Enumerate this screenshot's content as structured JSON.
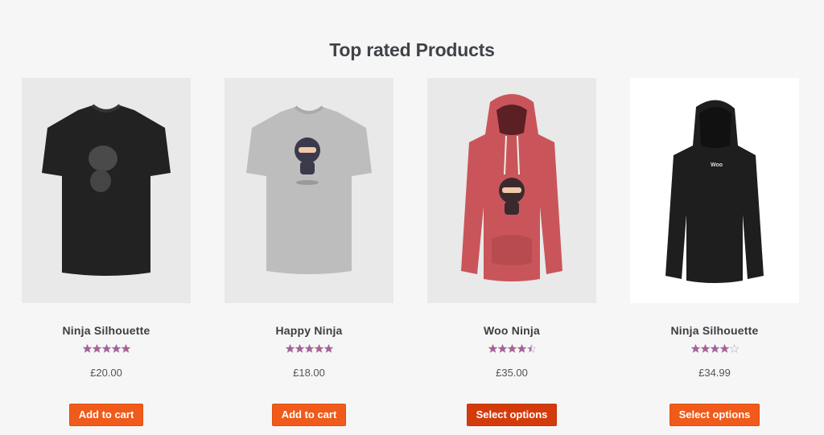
{
  "section": {
    "title": "Top rated Products"
  },
  "accent": "#f05a1a",
  "star_color": "#a46497",
  "products": [
    {
      "name": "Ninja Silhouette",
      "rating": 5,
      "price": "£20.00",
      "button": "Add to cart",
      "image_icon": "black-tshirt-icon"
    },
    {
      "name": "Happy Ninja",
      "rating": 5,
      "price": "£18.00",
      "button": "Add to cart",
      "image_icon": "grey-tshirt-icon"
    },
    {
      "name": "Woo Ninja",
      "rating": 4.5,
      "price": "£35.00",
      "button": "Select options",
      "image_icon": "red-hoodie-icon"
    },
    {
      "name": "Ninja Silhouette",
      "rating": 4,
      "price": "£34.99",
      "button": "Select options",
      "image_icon": "black-hoodie-icon",
      "logo_text": "Woo"
    }
  ]
}
